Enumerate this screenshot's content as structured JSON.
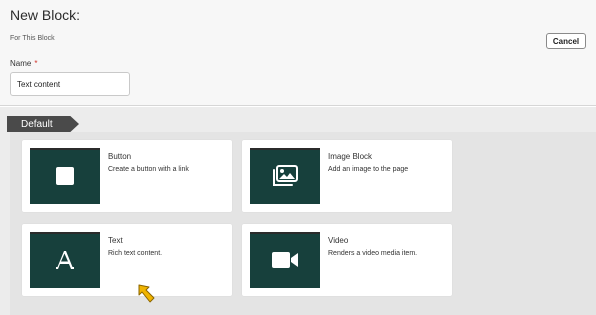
{
  "header": {
    "title": "New Block:",
    "subtitle": "For This Block",
    "cancel_label": "Cancel",
    "name_label": "Name",
    "required_mark": "*",
    "name_value": "Text content"
  },
  "section": {
    "tab_label": "Default"
  },
  "blocks": [
    {
      "title": "Button",
      "description": "Create a button with a link",
      "icon": "square-icon"
    },
    {
      "title": "Image Block",
      "description": "Add an image to the page",
      "icon": "images-icon"
    },
    {
      "title": "Text",
      "description": "Rich text content.",
      "icon": "letter-a-icon"
    },
    {
      "title": "Video",
      "description": "Renders a video media item.",
      "icon": "video-camera-icon"
    }
  ],
  "colors": {
    "thumbnail_bg": "#17403c",
    "tab_bg": "#4a4a4a",
    "required": "#d0342c",
    "cursor": "#f0b400"
  }
}
